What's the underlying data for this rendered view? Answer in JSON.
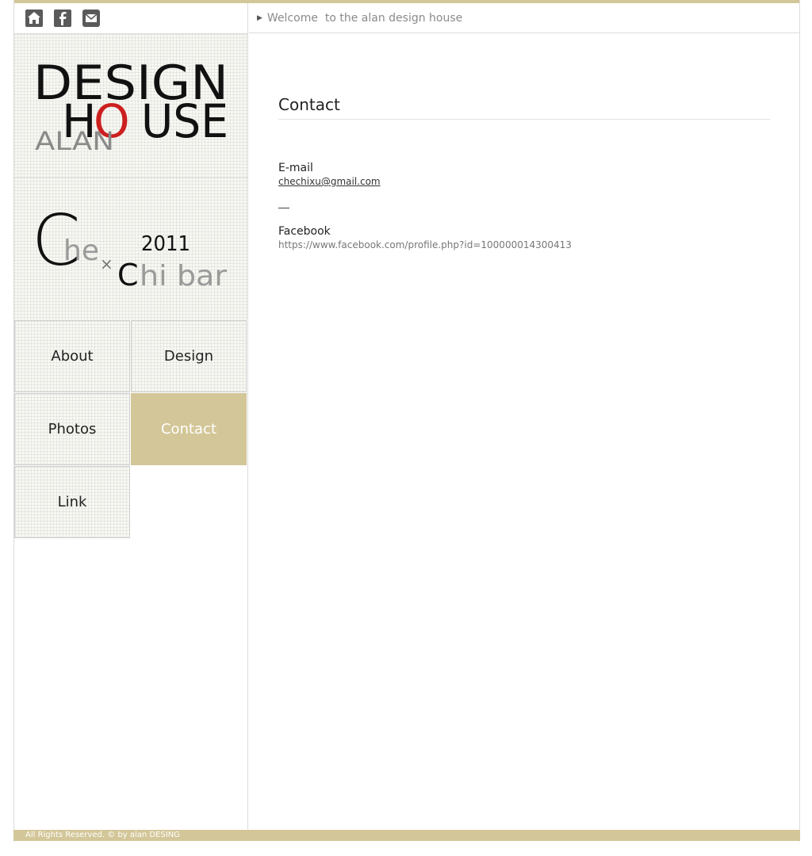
{
  "header": {
    "welcome": "Welcome  to the alan design house"
  },
  "icons": [
    "home-icon",
    "facebook-icon",
    "mail-icon"
  ],
  "logo": {
    "line1": "DESIGN",
    "line2_h": "H",
    "line2_o": "O",
    "line2_rest": "USE",
    "line3": "ALAN"
  },
  "promo": {
    "c1": "C",
    "he": "he",
    "x": "×",
    "year": "2011",
    "c2": "C",
    "chibar": "hi bar"
  },
  "nav": {
    "about": "About",
    "design": "Design",
    "photos": "Photos",
    "contact": "Contact",
    "link": "Link"
  },
  "content": {
    "title": "Contact",
    "email_label": "E-mail",
    "email_value": "chechixu@gmail.com",
    "facebook_label": "Facebook",
    "facebook_url": "https://www.facebook.com/profile.php?id=100000014300413"
  },
  "footer": {
    "text": "All Rights Reserved. © by alan DESING"
  },
  "colors": {
    "accent": "#d3c698",
    "red": "#cc1f1f"
  }
}
